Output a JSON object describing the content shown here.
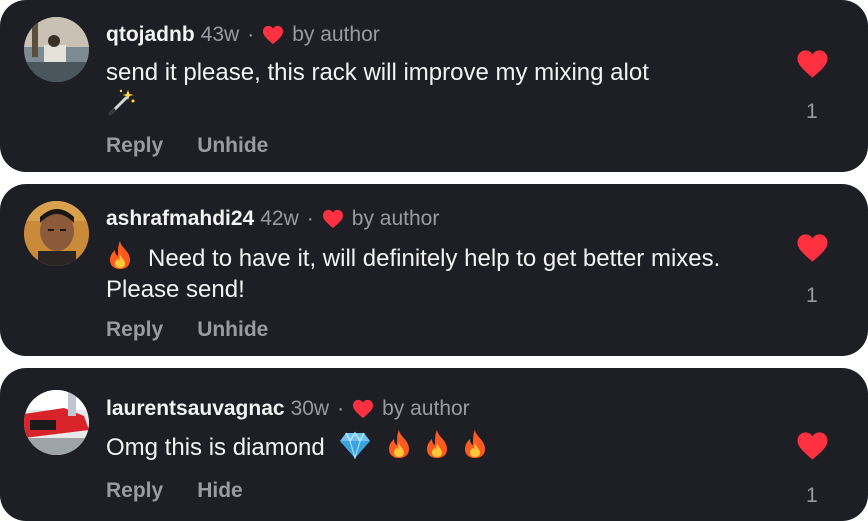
{
  "comments": [
    {
      "username": "qtojadnb",
      "age": "43w",
      "separator": "·",
      "liked_by": "by author",
      "text": "send it please, this rack will improve my mixing alot",
      "emoji_after": [
        "magic-wand"
      ],
      "actions": [
        "Reply",
        "Unhide"
      ],
      "like_count": "1"
    },
    {
      "username": "ashrafmahdi24",
      "age": "42w",
      "separator": "·",
      "liked_by": "by author",
      "text": "Need to have it, will definitely help to get better mixes. Please send!",
      "emoji_before": [
        "fire"
      ],
      "actions": [
        "Reply",
        "Unhide"
      ],
      "like_count": "1"
    },
    {
      "username": "laurentsauvagnac",
      "age": "30w",
      "separator": "·",
      "liked_by": "by author",
      "text": "Omg this is diamond",
      "emoji_after": [
        "gem",
        "fire",
        "fire",
        "fire"
      ],
      "actions": [
        "Reply",
        "Hide"
      ],
      "like_count": "1"
    }
  ],
  "colors": {
    "card_bg": "#1e1f24",
    "primary_text": "#f2f2f2",
    "secondary_text": "#9a9ba0",
    "heart": "#ff3040"
  }
}
